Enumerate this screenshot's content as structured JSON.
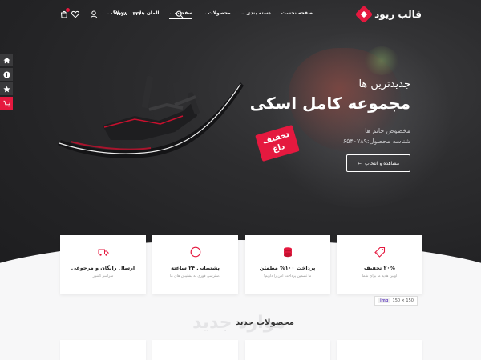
{
  "header": {
    "logo_text": "قالب ریود",
    "nav": [
      {
        "label": "صفحه نخست",
        "has_caret": false
      },
      {
        "label": "دسته بندی",
        "has_caret": true
      },
      {
        "label": "محصولات",
        "has_caret": true
      },
      {
        "label": "صفحات",
        "has_caret": true,
        "active": true
      },
      {
        "label": "المان ها",
        "has_caret": true
      },
      {
        "label": "وبلاگ",
        "has_caret": true
      }
    ],
    "phone": "۰۹۱۷۸۰۰۳۳۶۱",
    "icons": [
      "search-icon",
      "user-icon",
      "heart-icon",
      "cart-icon"
    ]
  },
  "side_toolbar": [
    {
      "icon": "home-icon"
    },
    {
      "icon": "info-icon"
    },
    {
      "icon": "star-icon"
    },
    {
      "icon": "cart-icon",
      "highlighted": true
    }
  ],
  "hero": {
    "subtitle": "جدیدترین ها",
    "title": "مجموعه کامل اسکی",
    "desc_line1": "مخصوص خانم ها",
    "desc_line2": "شناسه محصول:۶۵۴۰۷۸۹",
    "button_label": "مشاهده و انتخاب",
    "tag_line1": "تخفیف",
    "tag_line2": "داغ"
  },
  "features": [
    {
      "title": "۲۰% تخفیف",
      "desc": "اولین هدیه ما برای شما",
      "icon": "discount-tag-icon"
    },
    {
      "title": "پرداخت ۱۰۰% مطمئن",
      "desc": "ما تضمین پرداخت امن را داریم!",
      "icon": "coins-icon"
    },
    {
      "title": "پشتیبانی ۲۴ ساعته",
      "desc": "دسترسی فوری به پشتیبان های ما",
      "icon": "support-24-icon"
    },
    {
      "title": "ارسال رایگان و مرجوعی",
      "desc": "سراسر کشور",
      "icon": "delivery-truck-icon"
    }
  ],
  "img_badge": {
    "tag": "img",
    "size": "150 × 150"
  },
  "section": {
    "bg_text": "موارد جدید",
    "title": "محصولات جدید"
  },
  "colors": {
    "accent": "#e5193f",
    "hero_dark": "#2a2a2c",
    "page_bg": "#f7f7f8"
  }
}
